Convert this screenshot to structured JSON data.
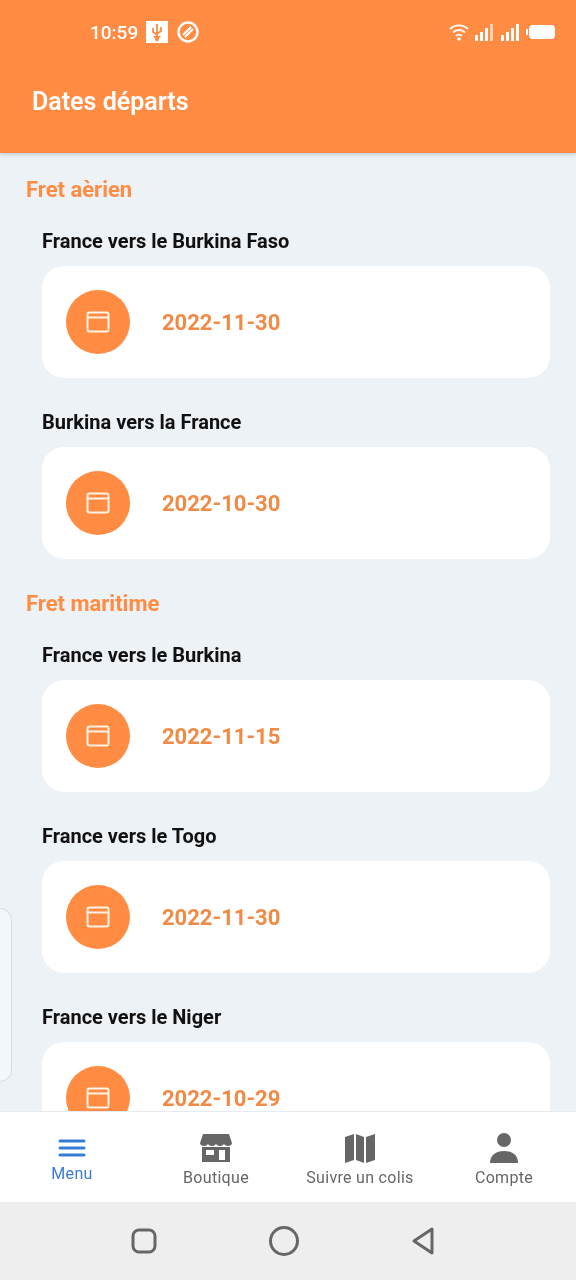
{
  "status_bar": {
    "time": "10:59"
  },
  "app_bar": {
    "title": "Dates départs"
  },
  "sections": [
    {
      "title": "Fret aèrien",
      "routes": [
        {
          "name": "France vers le Burkina Faso",
          "date": "2022-11-30"
        },
        {
          "name": "Burkina vers la France",
          "date": "2022-10-30"
        }
      ]
    },
    {
      "title": "Fret maritime",
      "routes": [
        {
          "name": "France vers le Burkina",
          "date": "2022-11-15"
        },
        {
          "name": "France vers le Togo",
          "date": "2022-11-30"
        },
        {
          "name": "France vers le Niger",
          "date": "2022-10-29"
        }
      ]
    }
  ],
  "bottom_nav": [
    {
      "label": "Menu",
      "selected": true
    },
    {
      "label": "Boutique",
      "selected": false
    },
    {
      "label": "Suivre un colis",
      "selected": false
    },
    {
      "label": "Compte",
      "selected": false
    }
  ]
}
